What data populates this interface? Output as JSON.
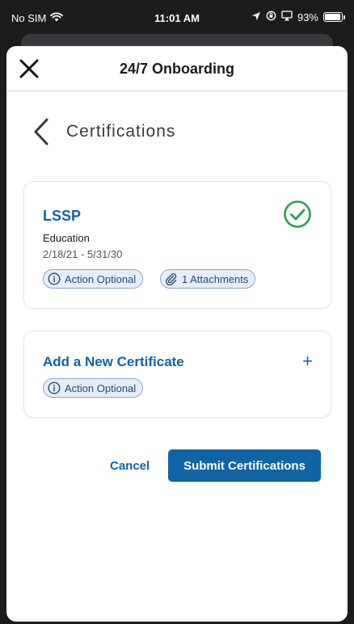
{
  "status_bar": {
    "carrier": "No SIM",
    "time": "11:01 AM",
    "battery_percent": "93%",
    "battery_level": 0.93,
    "icons": [
      "wifi-icon",
      "location-arrow-icon",
      "orientation-lock-icon",
      "airplay-icon",
      "battery-icon"
    ]
  },
  "header": {
    "title": "24/7 Onboarding",
    "close_icon": "close-icon"
  },
  "page": {
    "title": "Certifications",
    "back_icon": "chevron-left-icon"
  },
  "certificate": {
    "name": "LSSP",
    "type": "Education",
    "dates": "2/18/21 - 5/31/30",
    "status_icon": "check-circle-icon",
    "status_color": "#2e9d55",
    "chips": [
      {
        "label": "Action Optional",
        "icon": "info-circle-icon"
      },
      {
        "label": "1 Attachments",
        "icon": "paperclip-icon"
      }
    ]
  },
  "add_certificate": {
    "title": "Add a New Certificate",
    "plus_label": "+",
    "chip": {
      "label": "Action Optional",
      "icon": "info-circle-icon"
    }
  },
  "actions": {
    "cancel_label": "Cancel",
    "submit_label": "Submit Certifications"
  },
  "colors": {
    "accent": "#0f64a4",
    "chip_bg": "#e7eef8",
    "chip_border": "#8aa6c8"
  }
}
